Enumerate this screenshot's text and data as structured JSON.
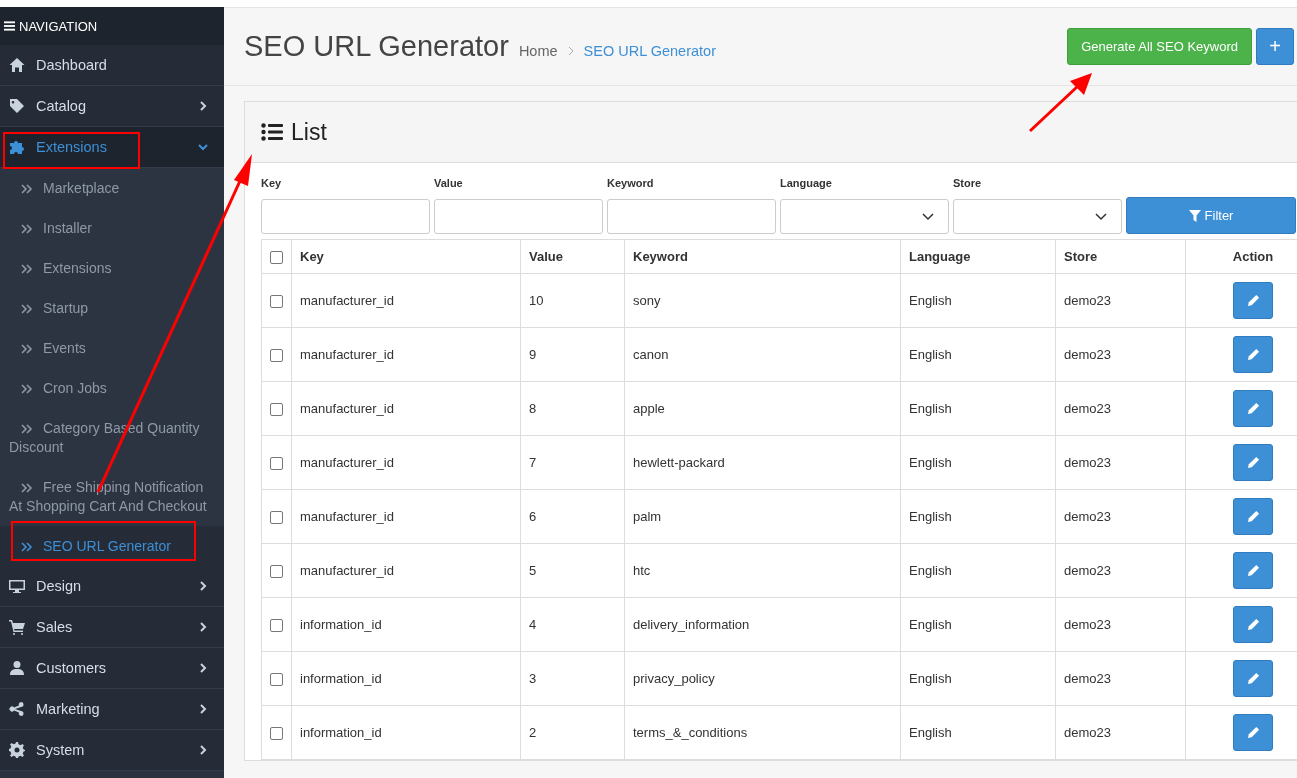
{
  "sidebar": {
    "title": "NAVIGATION",
    "items": [
      {
        "label": "Dashboard",
        "has_arrow": false,
        "selected": false
      },
      {
        "label": "Catalog",
        "has_arrow": true,
        "expanded": false,
        "selected": false
      },
      {
        "label": "Extensions",
        "has_arrow": true,
        "expanded": true,
        "selected": true,
        "children": [
          {
            "label": "Marketplace",
            "selected": false
          },
          {
            "label": "Installer",
            "selected": false
          },
          {
            "label": "Extensions",
            "selected": false
          },
          {
            "label": "Startup",
            "selected": false
          },
          {
            "label": "Events",
            "selected": false
          },
          {
            "label": "Cron Jobs",
            "selected": false
          },
          {
            "label": "Category Based Quantity Discount",
            "selected": false
          },
          {
            "label": "Free Shipping Notification At Shopping Cart And Checkout",
            "selected": false
          },
          {
            "label": "SEO URL Generator",
            "selected": true
          }
        ]
      },
      {
        "label": "Design",
        "has_arrow": true,
        "expanded": false,
        "selected": false
      },
      {
        "label": "Sales",
        "has_arrow": true,
        "expanded": false,
        "selected": false
      },
      {
        "label": "Customers",
        "has_arrow": true,
        "expanded": false,
        "selected": false
      },
      {
        "label": "Marketing",
        "has_arrow": true,
        "expanded": false,
        "selected": false
      },
      {
        "label": "System",
        "has_arrow": true,
        "expanded": false,
        "selected": false
      }
    ]
  },
  "header": {
    "title": "SEO URL Generator",
    "breadcrumb": [
      {
        "label": "Home",
        "selected": false
      },
      {
        "label": "SEO URL Generator",
        "selected": true
      }
    ],
    "buttons": [
      {
        "kind": "generate",
        "label": "Generate All SEO Keyword"
      },
      {
        "kind": "add",
        "label": "+"
      }
    ]
  },
  "panel": {
    "title": "List",
    "filters": [
      {
        "kind": "text",
        "label": "Key"
      },
      {
        "kind": "text",
        "label": "Value"
      },
      {
        "kind": "text",
        "label": "Keyword"
      },
      {
        "kind": "select",
        "label": "Language"
      },
      {
        "kind": "select",
        "label": "Store"
      }
    ],
    "filter_button": "Filter",
    "table": {
      "select_all_checked": false,
      "columns": [
        "Key",
        "Value",
        "Keyword",
        "Language",
        "Store",
        "Action"
      ],
      "rows": [
        {
          "checked": false,
          "cells": [
            "manufacturer_id",
            "10",
            "sony",
            "English",
            "demo23"
          ]
        },
        {
          "checked": false,
          "cells": [
            "manufacturer_id",
            "9",
            "canon",
            "English",
            "demo23"
          ]
        },
        {
          "checked": false,
          "cells": [
            "manufacturer_id",
            "8",
            "apple",
            "English",
            "demo23"
          ]
        },
        {
          "checked": false,
          "cells": [
            "manufacturer_id",
            "7",
            "hewlett-packard",
            "English",
            "demo23"
          ]
        },
        {
          "checked": false,
          "cells": [
            "manufacturer_id",
            "6",
            "palm",
            "English",
            "demo23"
          ]
        },
        {
          "checked": false,
          "cells": [
            "manufacturer_id",
            "5",
            "htc",
            "English",
            "demo23"
          ]
        },
        {
          "checked": false,
          "cells": [
            "information_id",
            "4",
            "delivery_information",
            "English",
            "demo23"
          ]
        },
        {
          "checked": false,
          "cells": [
            "information_id",
            "3",
            "privacy_policy",
            "English",
            "demo23"
          ]
        },
        {
          "checked": false,
          "cells": [
            "information_id",
            "2",
            "terms_&_conditions",
            "English",
            "demo23"
          ]
        }
      ]
    }
  }
}
